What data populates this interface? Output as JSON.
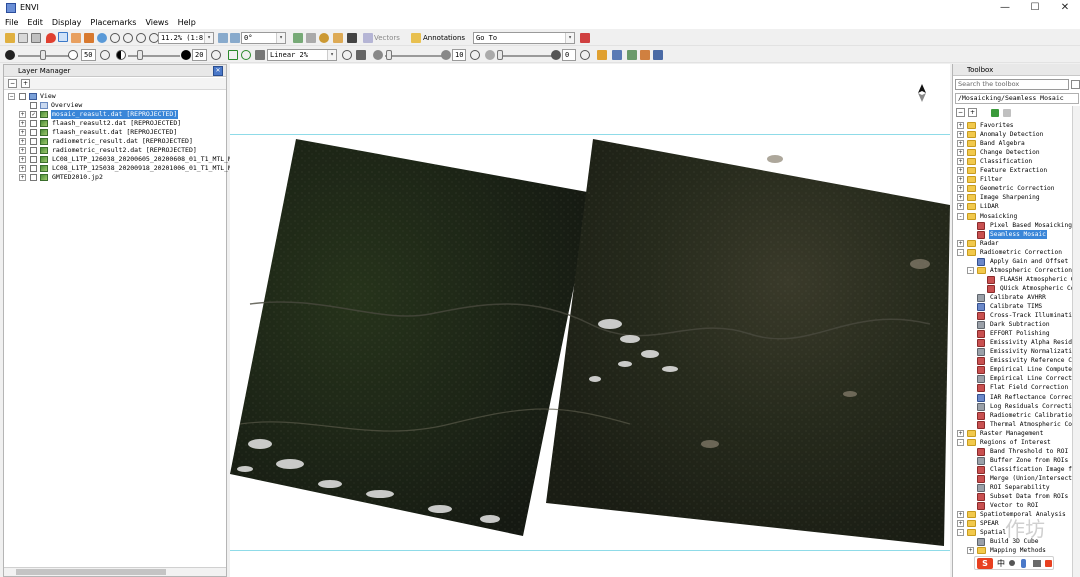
{
  "window": {
    "title": "ENVI",
    "controls": [
      "—",
      "☐",
      "✕"
    ]
  },
  "menu": [
    "File",
    "Edit",
    "Display",
    "Placemarks",
    "Views",
    "Help"
  ],
  "toolbar1": {
    "zoom_value": "11.2% (1:8.9",
    "rotation_value": "0°",
    "vectors_label": "Vectors",
    "annotations_label": "Annotations",
    "goto_value": "Go To"
  },
  "toolbar2": {
    "brightness_value": "50",
    "contrast_value": "20",
    "stretch_value": "Linear 2%",
    "sharpen_value": "10",
    "transparency_value": "0"
  },
  "layer_manager": {
    "title": "Layer Manager",
    "root": "View",
    "overview": "Overview",
    "layers": [
      {
        "label": "mosaic_reasult.dat [REPROJECTED]",
        "checked": true,
        "selected": true
      },
      {
        "label": "flaash_reasult2.dat [REPROJECTED]",
        "checked": false,
        "selected": false
      },
      {
        "label": "flaash_reasult.dat [REPROJECTED]",
        "checked": false,
        "selected": false
      },
      {
        "label": "radiometric_result.dat [REPROJECTED]",
        "checked": false,
        "selected": false
      },
      {
        "label": "radiometric_result2.dat [REPROJECTED]",
        "checked": false,
        "selected": false
      },
      {
        "label": "LC08_L1TP_126038_20200605_20200608_01_T1_MTL_MultiSp",
        "checked": false,
        "selected": false
      },
      {
        "label": "LC08_L1TP_125038_20200918_20201006_01_T1_MTL_MultiSp",
        "checked": false,
        "selected": false
      },
      {
        "label": "GMTED2010.jp2",
        "checked": false,
        "selected": false
      }
    ]
  },
  "toolbox": {
    "title": "Toolbox",
    "search_placeholder": "Search the toolbox",
    "path": "/Mosaicking/Seamless Mosaic",
    "items": [
      {
        "label": "Favorites",
        "kind": "folder",
        "indent": 0,
        "exp": "+"
      },
      {
        "label": "Anomaly Detection",
        "kind": "folder",
        "indent": 0,
        "exp": "+"
      },
      {
        "label": "Band Algebra",
        "kind": "folder",
        "indent": 0,
        "exp": "+"
      },
      {
        "label": "Change Detection",
        "kind": "folder",
        "indent": 0,
        "exp": "+"
      },
      {
        "label": "Classification",
        "kind": "folder",
        "indent": 0,
        "exp": "+"
      },
      {
        "label": "Feature Extraction",
        "kind": "folder",
        "indent": 0,
        "exp": "+"
      },
      {
        "label": "Filter",
        "kind": "folder",
        "indent": 0,
        "exp": "+"
      },
      {
        "label": "Geometric Correction",
        "kind": "folder",
        "indent": 0,
        "exp": "+"
      },
      {
        "label": "Image Sharpening",
        "kind": "folder",
        "indent": 0,
        "exp": "+"
      },
      {
        "label": "LiDAR",
        "kind": "folder",
        "indent": 0,
        "exp": "+"
      },
      {
        "label": "Mosaicking",
        "kind": "folder",
        "indent": 0,
        "exp": "-"
      },
      {
        "label": "Pixel Based Mosaicking",
        "kind": "tool",
        "indent": 1,
        "exp": ""
      },
      {
        "label": "Seamless Mosaic",
        "kind": "tool",
        "indent": 1,
        "exp": "",
        "selected": true
      },
      {
        "label": "Radar",
        "kind": "folder",
        "indent": 0,
        "exp": "+"
      },
      {
        "label": "Radiometric Correction",
        "kind": "folder",
        "indent": 0,
        "exp": "-"
      },
      {
        "label": "Apply Gain and Offset",
        "kind": "tool",
        "indent": 1,
        "exp": ""
      },
      {
        "label": "Atmospheric Correction Modu",
        "kind": "folder",
        "indent": 1,
        "exp": "-"
      },
      {
        "label": "FLAASH Atmospheric Corre",
        "kind": "tool",
        "indent": 2,
        "exp": ""
      },
      {
        "label": "QUick Atmospheric Correc",
        "kind": "tool",
        "indent": 2,
        "exp": ""
      },
      {
        "label": "Calibrate AVHRR",
        "kind": "tool",
        "indent": 1,
        "exp": ""
      },
      {
        "label": "Calibrate TIMS",
        "kind": "tool",
        "indent": 1,
        "exp": ""
      },
      {
        "label": "Cross-Track Illumination Co",
        "kind": "tool",
        "indent": 1,
        "exp": ""
      },
      {
        "label": "Dark Subtraction",
        "kind": "tool",
        "indent": 1,
        "exp": ""
      },
      {
        "label": "EFFORT Polishing",
        "kind": "tool",
        "indent": 1,
        "exp": ""
      },
      {
        "label": "Emissivity Alpha Residuals",
        "kind": "tool",
        "indent": 1,
        "exp": ""
      },
      {
        "label": "Emissivity Normalization",
        "kind": "tool",
        "indent": 1,
        "exp": ""
      },
      {
        "label": "Emissivity Reference Channe",
        "kind": "tool",
        "indent": 1,
        "exp": ""
      },
      {
        "label": "Empirical Line Compute Fact",
        "kind": "tool",
        "indent": 1,
        "exp": ""
      },
      {
        "label": "Empirical Line Correct Usin",
        "kind": "tool",
        "indent": 1,
        "exp": ""
      },
      {
        "label": "Flat Field Correction",
        "kind": "tool",
        "indent": 1,
        "exp": ""
      },
      {
        "label": "IAR Reflectance Correction",
        "kind": "tool",
        "indent": 1,
        "exp": ""
      },
      {
        "label": "Log Residuals Correction",
        "kind": "tool",
        "indent": 1,
        "exp": ""
      },
      {
        "label": "Radiometric Calibration",
        "kind": "tool",
        "indent": 1,
        "exp": ""
      },
      {
        "label": "Thermal Atmospheric Correct",
        "kind": "tool",
        "indent": 1,
        "exp": ""
      },
      {
        "label": "Raster Management",
        "kind": "folder",
        "indent": 0,
        "exp": "+"
      },
      {
        "label": "Regions of Interest",
        "kind": "folder",
        "indent": 0,
        "exp": "-"
      },
      {
        "label": "Band Threshold to ROI",
        "kind": "tool",
        "indent": 1,
        "exp": ""
      },
      {
        "label": "Buffer Zone from ROIs",
        "kind": "tool",
        "indent": 1,
        "exp": ""
      },
      {
        "label": "Classification Image from R",
        "kind": "tool",
        "indent": 1,
        "exp": ""
      },
      {
        "label": "Merge (Union/Intersection)",
        "kind": "tool",
        "indent": 1,
        "exp": ""
      },
      {
        "label": "ROI Separability",
        "kind": "tool",
        "indent": 1,
        "exp": ""
      },
      {
        "label": "Subset Data from ROIs",
        "kind": "tool",
        "indent": 1,
        "exp": ""
      },
      {
        "label": "Vector to ROI",
        "kind": "tool",
        "indent": 1,
        "exp": ""
      },
      {
        "label": "Spatiotemporal Analysis",
        "kind": "folder",
        "indent": 0,
        "exp": "+"
      },
      {
        "label": "SPEAR",
        "kind": "folder",
        "indent": 0,
        "exp": "+"
      },
      {
        "label": "Spatial",
        "kind": "folder",
        "indent": 0,
        "exp": "-"
      },
      {
        "label": "Build 3D Cube",
        "kind": "tool",
        "indent": 1,
        "exp": ""
      },
      {
        "label": "Mapping Methods",
        "kind": "folder",
        "indent": 1,
        "exp": "+"
      }
    ]
  },
  "ime": {
    "glyph": "S",
    "lang": "中"
  },
  "watermark": "作坊"
}
